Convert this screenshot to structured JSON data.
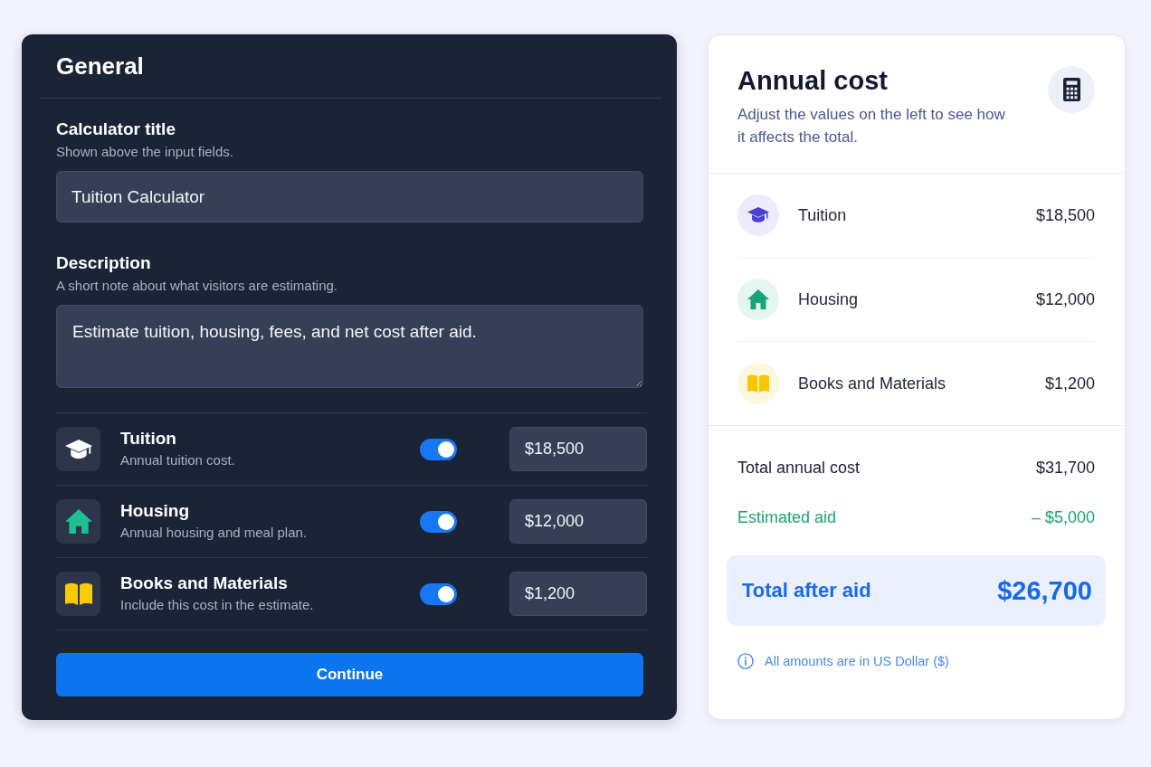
{
  "editor": {
    "title": "General",
    "fields": [
      {
        "kind": "text",
        "label": "Calculator title",
        "hint": "Shown above the input fields.",
        "value": "Tuition Calculator"
      },
      {
        "kind": "multiline",
        "label": "Description",
        "hint": "A short note about what visitors are estimating.",
        "value": "Estimate tuition, housing, fees, and net cost after aid."
      }
    ],
    "cost_items": [
      {
        "kind": "cap",
        "name": "Tuition",
        "note": "Annual tuition cost.",
        "on": true,
        "amount": "$18,500"
      },
      {
        "kind": "house",
        "name": "Housing",
        "note": "Annual housing and meal plan.",
        "on": true,
        "amount": "$12,000"
      },
      {
        "kind": "book",
        "name": "Books and Materials",
        "note": "Include this cost in the estimate.",
        "on": true,
        "amount": "$1,200"
      }
    ],
    "button": "Continue"
  },
  "summary": {
    "title": "Annual cost",
    "subtitle": "Adjust the values on the left to see how it affects the total.",
    "items": [
      {
        "kind": "cap",
        "name": "Tuition",
        "amount": "$18,500"
      },
      {
        "kind": "house",
        "name": "Housing",
        "amount": "$12,000"
      },
      {
        "kind": "book",
        "name": "Books and Materials",
        "amount": "$1,200"
      }
    ],
    "totals": [
      {
        "kind": "sum",
        "label": "Total annual cost",
        "amount": "$31,700"
      },
      {
        "kind": "deduction",
        "label": "Estimated aid",
        "amount": "– $5,000"
      }
    ],
    "net": {
      "label": "Total after aid",
      "amount": "$26,700"
    },
    "note": "All amounts are in US Dollar ($)"
  }
}
